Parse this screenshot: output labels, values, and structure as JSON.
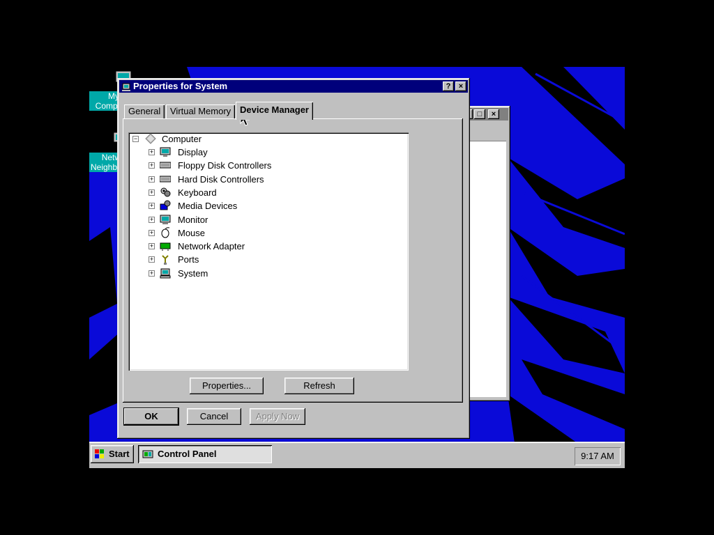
{
  "desktop": {
    "icons": [
      {
        "label": "My Computer"
      },
      {
        "label": "Network Neighborhood"
      }
    ]
  },
  "dialog": {
    "title": "Properties for System",
    "help_glyph": "?",
    "close_glyph": "×",
    "tabs": [
      {
        "label": "General",
        "active": false
      },
      {
        "label": "Virtual Memory",
        "active": false
      },
      {
        "label": "Device Manager",
        "active": true
      }
    ],
    "tree": {
      "root": "Computer",
      "items": [
        {
          "label": "Display",
          "icon": "display-icon"
        },
        {
          "label": "Floppy Disk Controllers",
          "icon": "controller-icon"
        },
        {
          "label": "Hard Disk Controllers",
          "icon": "controller-icon"
        },
        {
          "label": "Keyboard",
          "icon": "keyboard-icon"
        },
        {
          "label": "Media Devices",
          "icon": "media-icon"
        },
        {
          "label": "Monitor",
          "icon": "monitor-icon"
        },
        {
          "label": "Mouse",
          "icon": "mouse-icon"
        },
        {
          "label": "Network Adapter",
          "icon": "network-icon"
        },
        {
          "label": "Ports",
          "icon": "ports-icon"
        },
        {
          "label": "System",
          "icon": "system-icon"
        }
      ]
    },
    "properties_button": "Properties...",
    "refresh_button": "Refresh",
    "ok_button": "OK",
    "cancel_button": "Cancel",
    "apply_button": "Apply Now"
  },
  "taskbar": {
    "start_label": "Start",
    "task_label": "Control Panel",
    "clock": "9:17 AM"
  },
  "colors": {
    "desktop": "#0a0ad8",
    "titlebar_active": "#00007b",
    "titlebar_inactive": "#808080",
    "face": "#c0c0c0",
    "icon_label": "#00a8a8"
  }
}
